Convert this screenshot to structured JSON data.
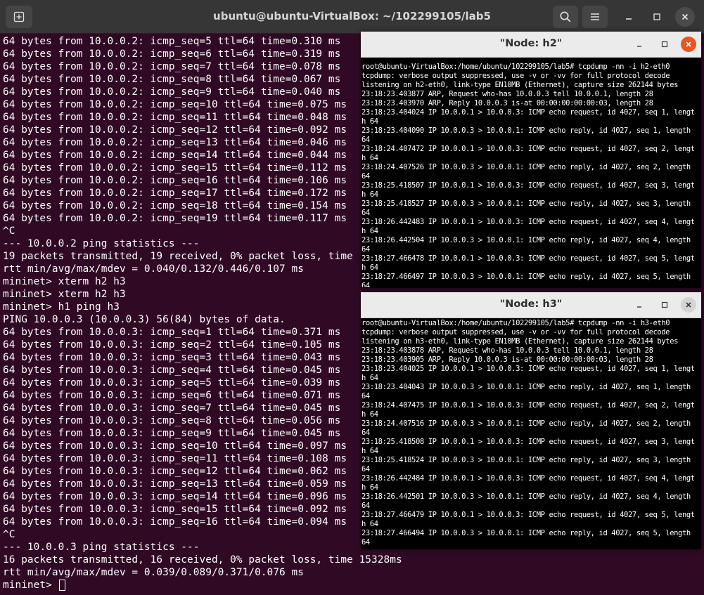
{
  "main": {
    "title": "ubuntu@ubuntu-VirtualBox: ~/102299105/lab5",
    "lines": [
      "64 bytes from 10.0.0.2: icmp_seq=5 ttl=64 time=0.310 ms",
      "64 bytes from 10.0.0.2: icmp_seq=6 ttl=64 time=0.319 ms",
      "64 bytes from 10.0.0.2: icmp_seq=7 ttl=64 time=0.078 ms",
      "64 bytes from 10.0.0.2: icmp_seq=8 ttl=64 time=0.067 ms",
      "64 bytes from 10.0.0.2: icmp_seq=9 ttl=64 time=0.040 ms",
      "64 bytes from 10.0.0.2: icmp_seq=10 ttl=64 time=0.075 ms",
      "64 bytes from 10.0.0.2: icmp_seq=11 ttl=64 time=0.048 ms",
      "64 bytes from 10.0.0.2: icmp_seq=12 ttl=64 time=0.092 ms",
      "64 bytes from 10.0.0.2: icmp_seq=13 ttl=64 time=0.046 ms",
      "64 bytes from 10.0.0.2: icmp_seq=14 ttl=64 time=0.044 ms",
      "64 bytes from 10.0.0.2: icmp_seq=15 ttl=64 time=0.112 ms",
      "64 bytes from 10.0.0.2: icmp_seq=16 ttl=64 time=0.106 ms",
      "64 bytes from 10.0.0.2: icmp_seq=17 ttl=64 time=0.172 ms",
      "64 bytes from 10.0.0.2: icmp_seq=18 ttl=64 time=0.154 ms",
      "64 bytes from 10.0.0.2: icmp_seq=19 ttl=64 time=0.117 ms",
      "^C",
      "--- 10.0.0.2 ping statistics ---",
      "19 packets transmitted, 19 received, 0% packet loss, time",
      "rtt min/avg/max/mdev = 0.040/0.132/0.446/0.107 ms",
      "mininet> xterm h2 h3",
      "mininet> xterm h2 h3",
      "mininet> h1 ping h3",
      "PING 10.0.0.3 (10.0.0.3) 56(84) bytes of data.",
      "64 bytes from 10.0.0.3: icmp_seq=1 ttl=64 time=0.371 ms",
      "64 bytes from 10.0.0.3: icmp_seq=2 ttl=64 time=0.105 ms",
      "64 bytes from 10.0.0.3: icmp_seq=3 ttl=64 time=0.043 ms",
      "64 bytes from 10.0.0.3: icmp_seq=4 ttl=64 time=0.045 ms",
      "64 bytes from 10.0.0.3: icmp_seq=5 ttl=64 time=0.039 ms",
      "64 bytes from 10.0.0.3: icmp_seq=6 ttl=64 time=0.071 ms",
      "64 bytes from 10.0.0.3: icmp_seq=7 ttl=64 time=0.045 ms",
      "64 bytes from 10.0.0.3: icmp_seq=8 ttl=64 time=0.056 ms",
      "64 bytes from 10.0.0.3: icmp_seq=9 ttl=64 time=0.045 ms",
      "64 bytes from 10.0.0.3: icmp_seq=10 ttl=64 time=0.097 ms",
      "64 bytes from 10.0.0.3: icmp_seq=11 ttl=64 time=0.108 ms",
      "64 bytes from 10.0.0.3: icmp_seq=12 ttl=64 time=0.062 ms",
      "64 bytes from 10.0.0.3: icmp_seq=13 ttl=64 time=0.059 ms",
      "64 bytes from 10.0.0.3: icmp_seq=14 ttl=64 time=0.096 ms",
      "64 bytes from 10.0.0.3: icmp_seq=15 ttl=64 time=0.092 ms",
      "64 bytes from 10.0.0.3: icmp_seq=16 ttl=64 time=0.094 ms",
      "^C",
      "--- 10.0.0.3 ping statistics ---",
      "16 packets transmitted, 16 received, 0% packet loss, time 15328ms",
      "rtt min/avg/max/mdev = 0.039/0.089/0.371/0.076 ms"
    ],
    "prompt": "mininet> "
  },
  "h2": {
    "title": "\"Node: h2\"",
    "lines": [
      "root@ubuntu-VirtualBox:/home/ubuntu/102299105/lab5# tcpdump -nn -i h2-eth0",
      "tcpdump: verbose output suppressed, use -v or -vv for full protocol decode",
      "listening on h2-eth0, link-type EN10MB (Ethernet), capture size 262144 bytes",
      "23:18:23.403877 ARP, Request who-has 10.0.0.3 tell 10.0.0.1, length 28",
      "23:18:23.403970 ARP, Reply 10.0.0.3 is-at 00:00:00:00:00:03, length 28",
      "23:18:23.404024 IP 10.0.0.1 > 10.0.0.3: ICMP echo request, id 4027, seq 1, lengt",
      "h 64",
      "23:18:23.404090 IP 10.0.0.3 > 10.0.0.1: ICMP echo reply, id 4027, seq 1, length",
      "64",
      "23:18:24.407472 IP 10.0.0.1 > 10.0.0.3: ICMP echo request, id 4027, seq 2, lengt",
      "h 64",
      "23:18:24.407526 IP 10.0.0.3 > 10.0.0.1: ICMP echo reply, id 4027, seq 2, length",
      "64",
      "23:18:25.418507 IP 10.0.0.1 > 10.0.0.3: ICMP echo request, id 4027, seq 3, lengt",
      "h 64",
      "23:18:25.418527 IP 10.0.0.3 > 10.0.0.1: ICMP echo reply, id 4027, seq 3, length",
      "64",
      "23:18:26.442483 IP 10.0.0.1 > 10.0.0.3: ICMP echo request, id 4027, seq 4, lengt",
      "h 64",
      "23:18:26.442504 IP 10.0.0.3 > 10.0.0.1: ICMP echo reply, id 4027, seq 4, length",
      "64",
      "23:18:27.466478 IP 10.0.0.1 > 10.0.0.3: ICMP echo request, id 4027, seq 5, lengt",
      "h 64",
      "23:18:27.466497 IP 10.0.0.3 > 10.0.0.1: ICMP echo reply, id 4027, seq 5, length",
      "64"
    ]
  },
  "h3": {
    "title": "\"Node: h3\"",
    "lines": [
      "root@ubuntu-VirtualBox:/home/ubuntu/102299105/lab5# tcpdump -nn -i h3-eth0",
      "tcpdump: verbose output suppressed, use -v or -vv for full protocol decode",
      "listening on h3-eth0, link-type EN10MB (Ethernet), capture size 262144 bytes",
      "23:18:23.403878 ARP, Request who-has 10.0.0.3 tell 10.0.0.1, length 28",
      "23:18:23.403905 ARP, Reply 10.0.0.3 is-at 00:00:00:00:00:03, length 28",
      "23:18:23.404025 IP 10.0.0.1 > 10.0.0.3: ICMP echo request, id 4027, seq 1, lengt",
      "h 64",
      "23:18:23.404043 IP 10.0.0.3 > 10.0.0.1: ICMP echo reply, id 4027, seq 1, length",
      "64",
      "23:18:24.407475 IP 10.0.0.1 > 10.0.0.3: ICMP echo request, id 4027, seq 2, lengt",
      "h 64",
      "23:18:24.407516 IP 10.0.0.3 > 10.0.0.1: ICMP echo reply, id 4027, seq 2, length",
      "64",
      "23:18:25.418508 IP 10.0.0.1 > 10.0.0.3: ICMP echo request, id 4027, seq 3, lengt",
      "h 64",
      "23:18:25.418524 IP 10.0.0.3 > 10.0.0.1: ICMP echo reply, id 4027, seq 3, length",
      "64",
      "23:18:26.442484 IP 10.0.0.1 > 10.0.0.3: ICMP echo request, id 4027, seq 4, lengt",
      "h 64",
      "23:18:26.442501 IP 10.0.0.3 > 10.0.0.1: ICMP echo reply, id 4027, seq 4, length",
      "64",
      "23:18:27.466479 IP 10.0.0.1 > 10.0.0.3: ICMP echo request, id 4027, seq 5, lengt",
      "h 64",
      "23:18:27.466494 IP 10.0.0.3 > 10.0.0.1: ICMP echo reply, id 4027, seq 5, length",
      "64"
    ]
  },
  "icons": {
    "new_tab": "new-tab-icon",
    "search": "search-icon",
    "menu": "hamburger-menu-icon",
    "minimize": "minimize-icon",
    "maximize": "maximize-icon",
    "close": "close-icon"
  },
  "colors": {
    "terminal_bg": "#300a24",
    "headerbar": "#363636",
    "xterm_bg": "#000000",
    "xterm_titlebar": "#ebebeb",
    "close_accent": "#e95420"
  }
}
